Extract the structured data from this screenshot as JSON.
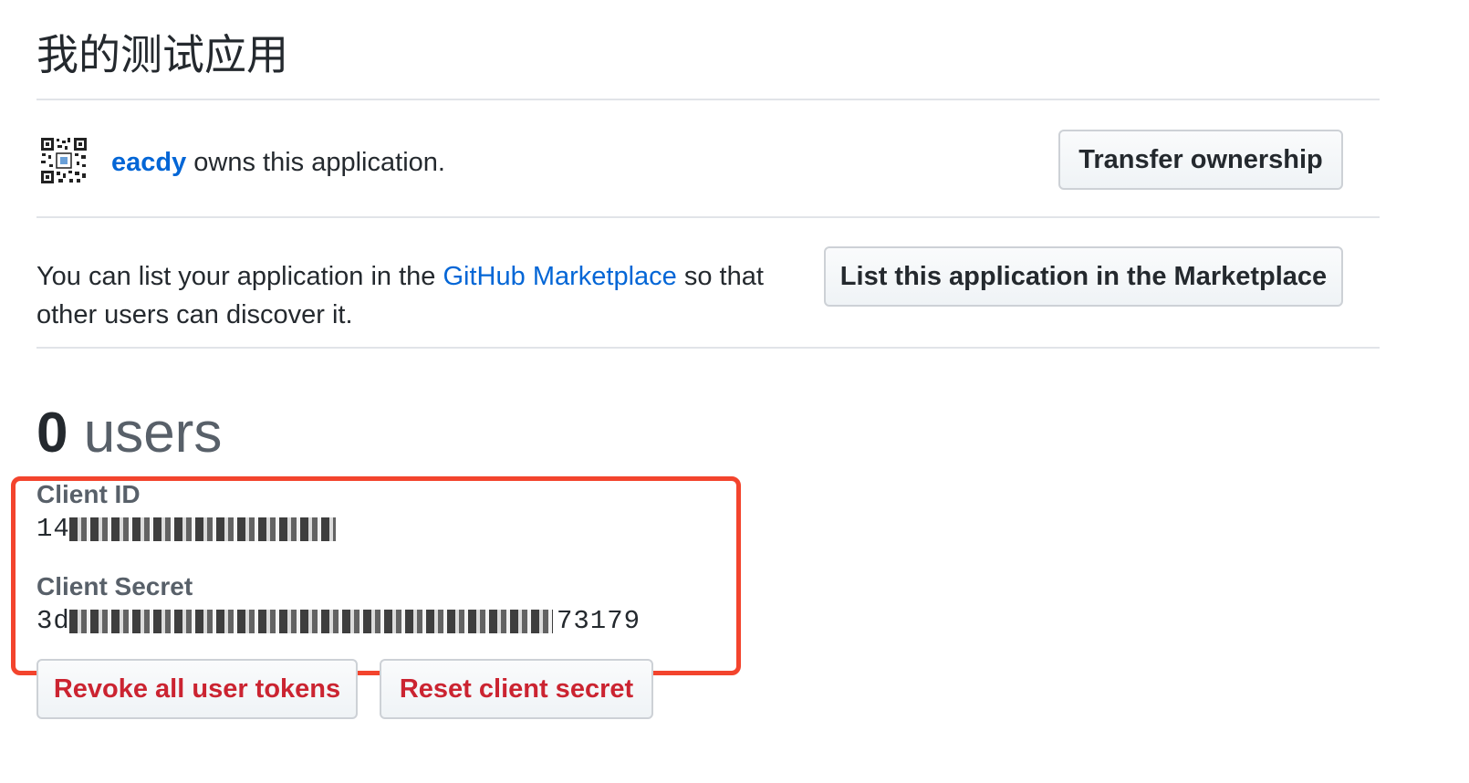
{
  "app": {
    "title": "我的测试应用"
  },
  "owner": {
    "username": "eacdy",
    "suffix_text": " owns this application.",
    "avatar_icon": "qr-code-avatar-icon",
    "transfer_button_label": "Transfer ownership"
  },
  "marketplace": {
    "text_before": "You can list your application in the ",
    "link_text": "GitHub Marketplace",
    "text_after": " so that other users can discover it.",
    "list_button_label": "List this application in the Marketplace"
  },
  "users": {
    "count": "0",
    "label": " users"
  },
  "credentials": {
    "client_id_label": "Client ID",
    "client_id_value": "14",
    "client_secret_label": "Client Secret",
    "client_secret_value_start": "3d",
    "client_secret_value_end": "73179",
    "highlight_color": "#f3442d"
  },
  "actions": {
    "revoke_label": "Revoke all user tokens",
    "reset_label": "Reset client secret"
  },
  "colors": {
    "link": "#0366d6",
    "danger": "#cb2431",
    "text": "#24292e",
    "muted": "#586069"
  }
}
